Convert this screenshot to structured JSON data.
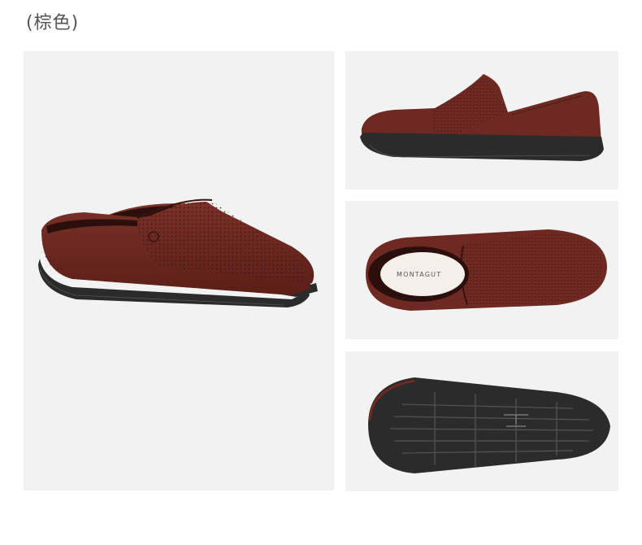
{
  "color_label": "(棕色)",
  "insole_brand": "MONTAGUT",
  "colors": {
    "leather": "#6e2a22",
    "leather_dark": "#4a1a15",
    "sole": "#2b2b2b",
    "panel_bg": "#f2f2f2"
  }
}
